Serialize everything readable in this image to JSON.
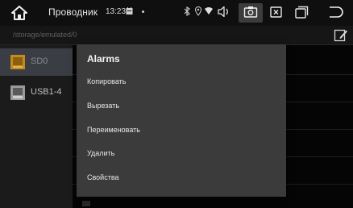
{
  "topbar": {
    "title": "Проводник",
    "time": "13:23",
    "icons": [
      "home-icon",
      "notification-icon",
      "bluetooth-icon",
      "location-icon",
      "wifi-icon",
      "volume-icon",
      "screenshot-icon",
      "close-box-icon",
      "windows-icon",
      "back-icon"
    ]
  },
  "pathbar": {
    "path": "/storage/emulated/0"
  },
  "sidebar": {
    "items": [
      {
        "label": "SD0",
        "selected": true
      },
      {
        "label": "USB1-4",
        "selected": false
      }
    ]
  },
  "popup": {
    "title": "Alarms",
    "items": [
      {
        "label": "Копировать"
      },
      {
        "label": "Вырезать"
      },
      {
        "label": "Переименовать"
      },
      {
        "label": "Удалить"
      },
      {
        "label": "Свойства"
      }
    ]
  },
  "colors": {
    "popup_bg": "#3b3b3b",
    "selected_bg": "#3a3d44",
    "sdcard_accent": "#c58a1c"
  }
}
